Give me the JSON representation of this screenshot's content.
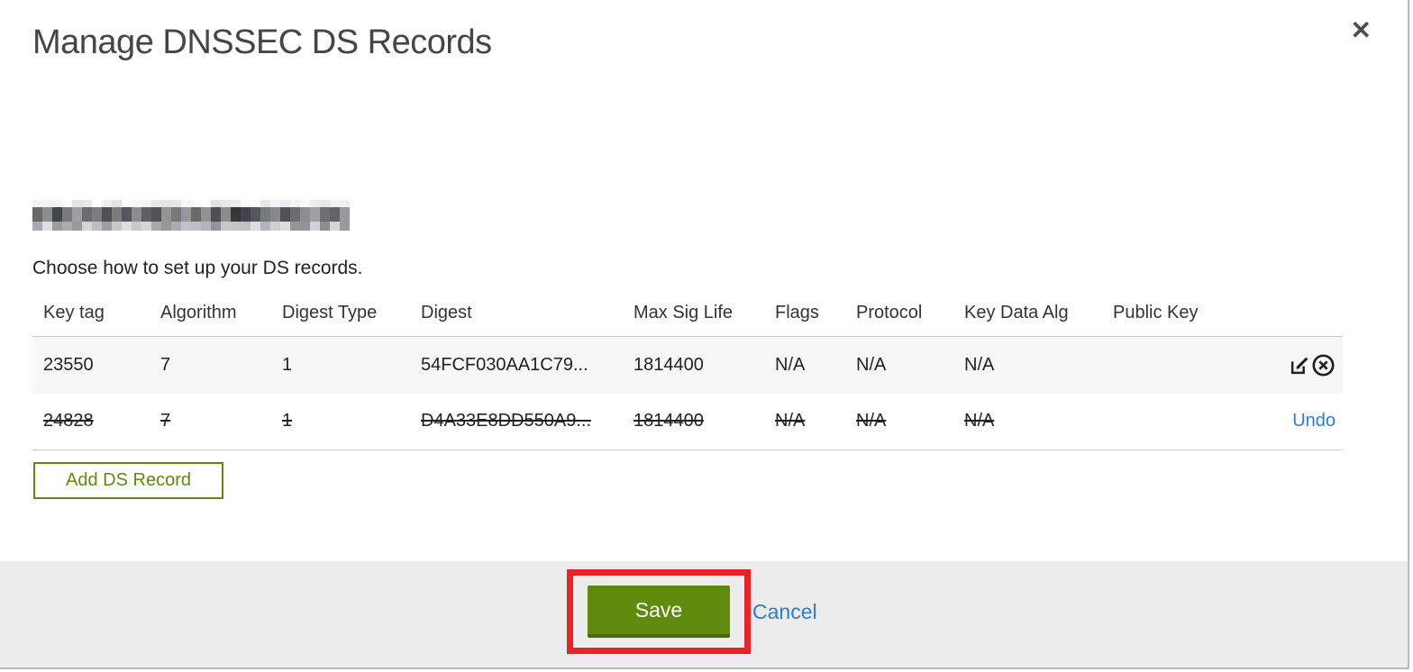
{
  "modal": {
    "title": "Manage DNSSEC DS Records",
    "close_glyph": "✕",
    "domain_redacted": true,
    "instruction": "Choose how to set up your DS records."
  },
  "table": {
    "columns": [
      "Key tag",
      "Algorithm",
      "Digest Type",
      "Digest",
      "Max Sig Life",
      "Flags",
      "Protocol",
      "Key Data Alg",
      "Public Key"
    ],
    "rows": [
      {
        "cells": [
          "23550",
          "7",
          "1",
          "54FCF030AA1C79...",
          "1814400",
          "N/A",
          "N/A",
          "N/A",
          ""
        ],
        "state": "normal",
        "actions": [
          "edit",
          "delete"
        ]
      },
      {
        "cells": [
          "24828",
          "7",
          "1",
          "D4A33E8DD550A9...",
          "1814400",
          "N/A",
          "N/A",
          "N/A",
          ""
        ],
        "state": "deleted",
        "undo_label": "Undo"
      }
    ]
  },
  "buttons": {
    "add_ds_record": "Add DS Record",
    "save": "Save",
    "cancel": "Cancel"
  },
  "colors": {
    "action_green": "#5f8a0b",
    "link_blue": "#2b7cdf",
    "annotation_red": "#ea2328",
    "footer_gray": "#ececec"
  }
}
